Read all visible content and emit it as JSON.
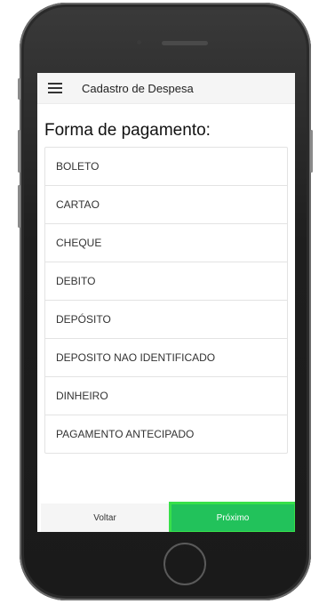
{
  "app": {
    "title": "Cadastro de Despesa"
  },
  "section": {
    "title": "Forma de pagamento:"
  },
  "payment_methods": [
    {
      "label": "BOLETO"
    },
    {
      "label": "CARTAO"
    },
    {
      "label": "CHEQUE"
    },
    {
      "label": "DEBITO"
    },
    {
      "label": "DEPÓSITO"
    },
    {
      "label": "DEPOSITO NAO IDENTIFICADO"
    },
    {
      "label": "DINHEIRO"
    },
    {
      "label": "PAGAMENTO ANTECIPADO"
    }
  ],
  "footer": {
    "back_label": "Voltar",
    "next_label": "Próximo"
  },
  "colors": {
    "accent": "#22c25b",
    "accent_highlight": "#38e04a"
  },
  "icons": {
    "menu": "hamburger-menu-icon"
  }
}
